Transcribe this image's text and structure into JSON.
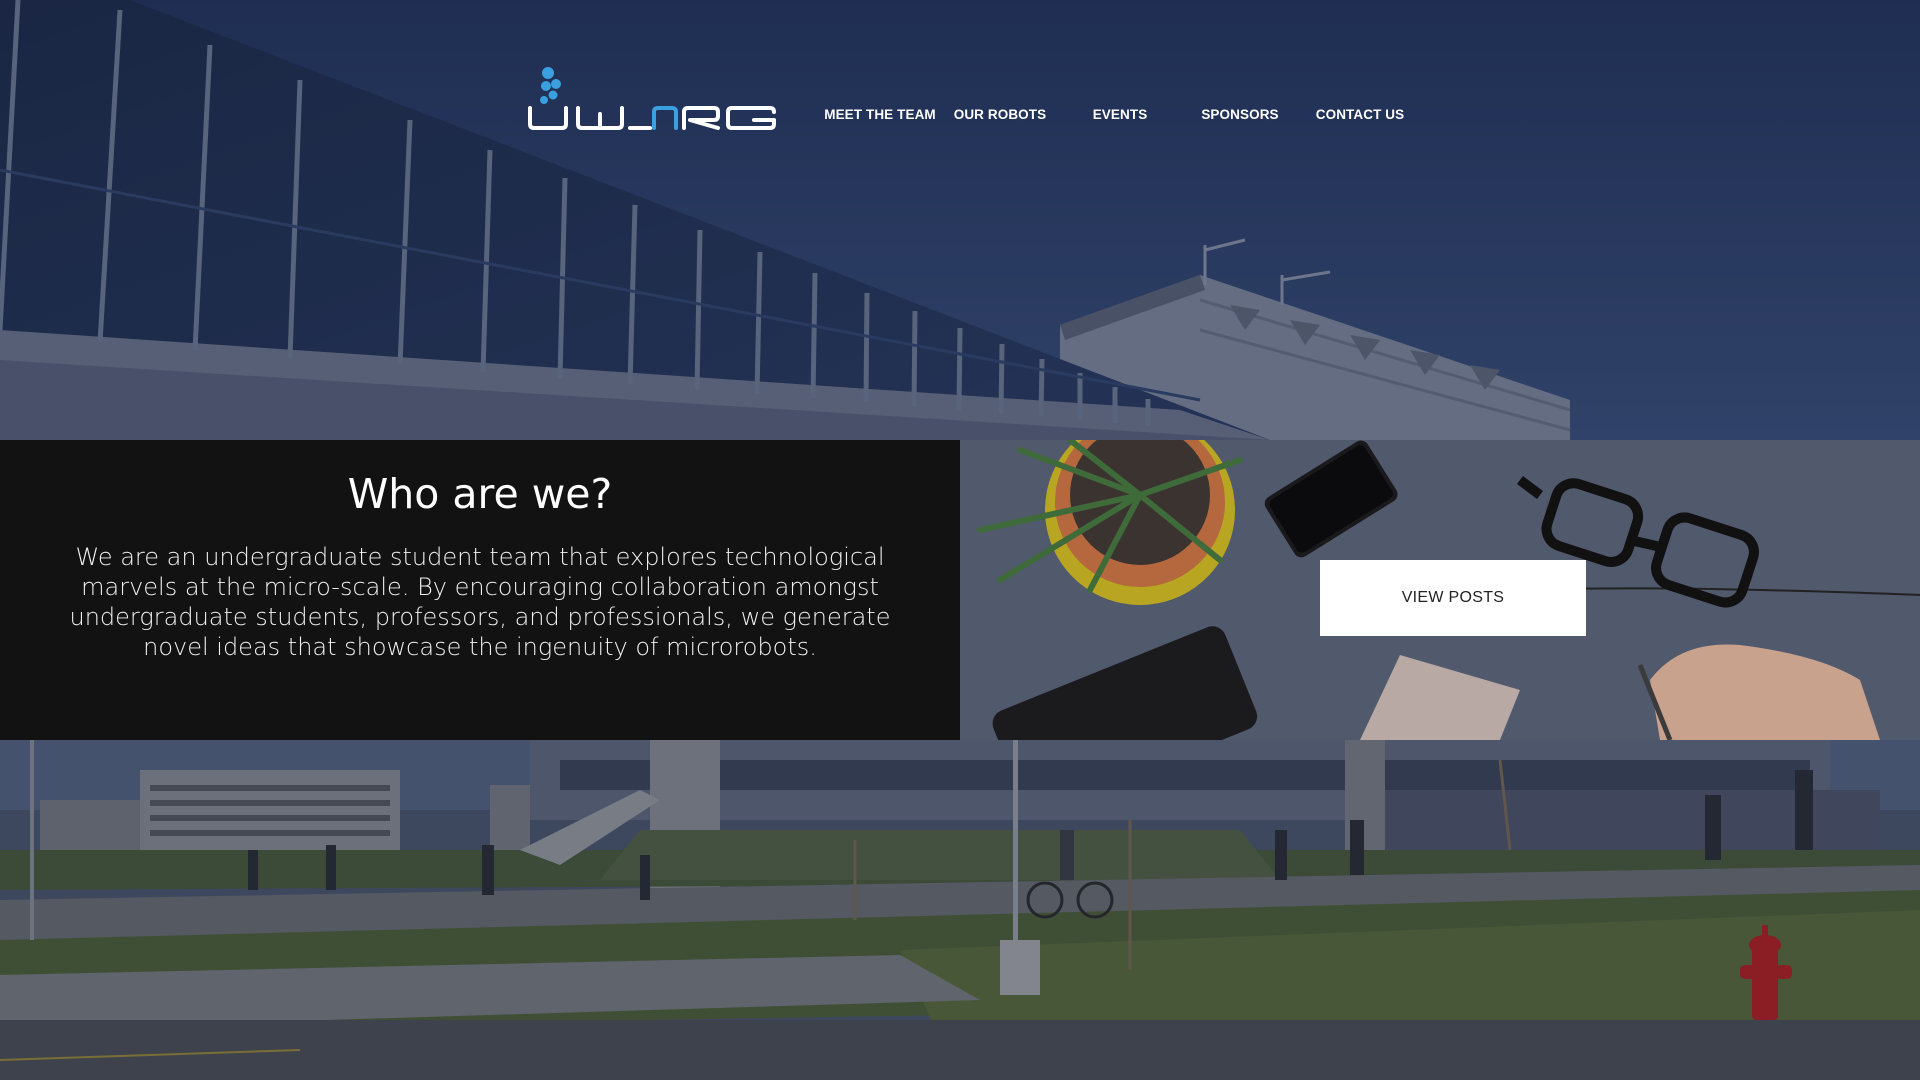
{
  "header": {
    "logo_alt": "UWNRG",
    "nav": [
      {
        "label": "MEET THE TEAM"
      },
      {
        "label": "OUR ROBOTS"
      },
      {
        "label": "EVENTS"
      },
      {
        "label": "SPONSORS"
      },
      {
        "label": "CONTACT US"
      }
    ]
  },
  "about": {
    "title": "Who are we?",
    "body": "We are an undergraduate student team that explores technological marvels at the micro-scale. By encouraging collaboration amongst undergraduate students, professors, and professionals, we generate novel ideas that showcase the ingenuity of microrobots."
  },
  "posts": {
    "button_label": "VIEW POSTS"
  },
  "colors": {
    "logo_accent": "#3aa0e0",
    "hero_sky": "#2c3f68",
    "about_bg": "#121212"
  }
}
